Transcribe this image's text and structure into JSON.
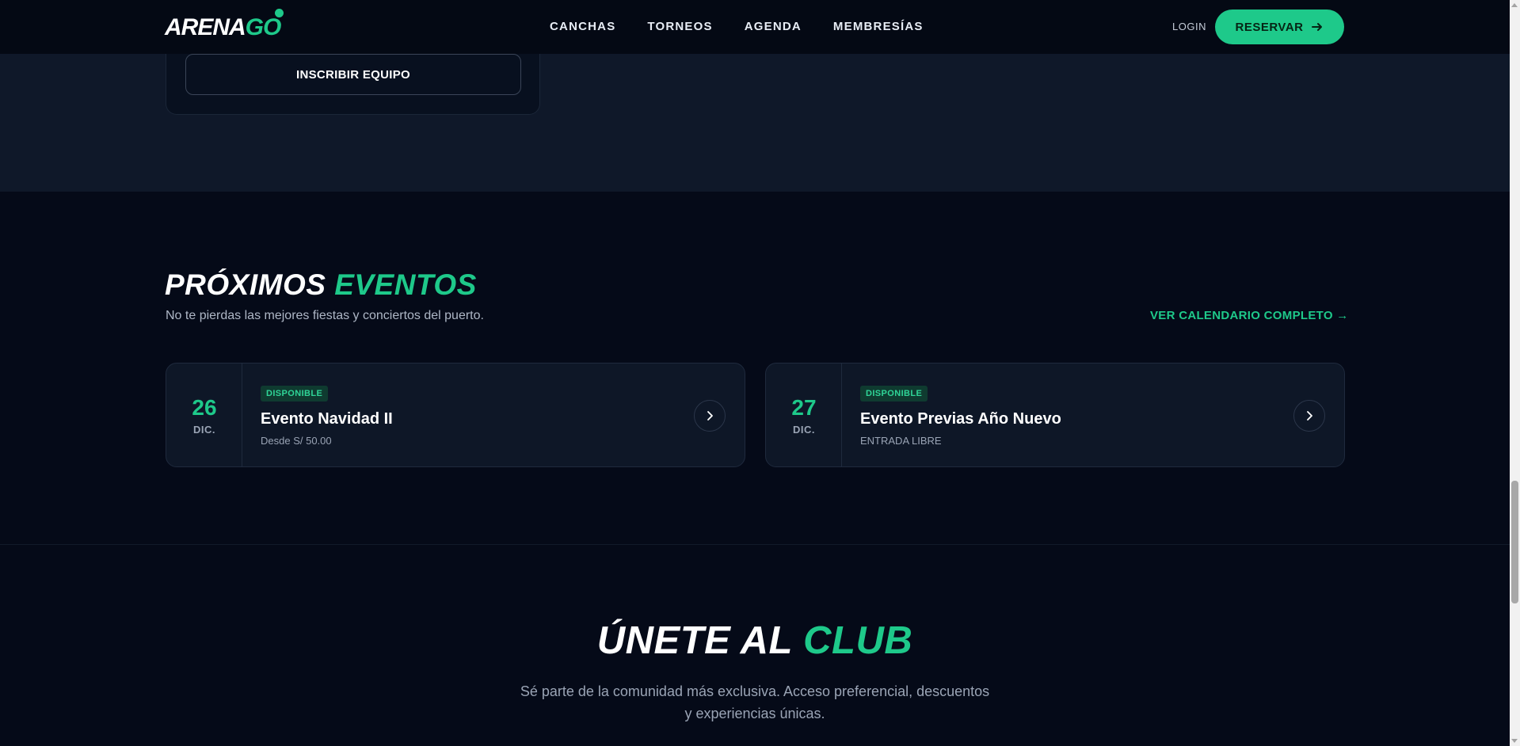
{
  "brand": {
    "logo_main": "ARENA",
    "logo_accent": "GO"
  },
  "nav": {
    "items": [
      "CANCHAS",
      "TORNEOS",
      "AGENDA",
      "MEMBRESÍAS"
    ]
  },
  "header": {
    "login_label": "LOGIN",
    "reserve_label": "RESERVAR"
  },
  "tournament": {
    "register_label": "INSCRIBIR EQUIPO"
  },
  "events": {
    "title_main": "PRÓXIMOS",
    "title_accent": "EVENTOS",
    "subtitle": "No te pierdas las mejores fiestas y conciertos del puerto.",
    "calendar_link": "VER CALENDARIO COMPLETO →",
    "items": [
      {
        "day": "26",
        "month": "DIC.",
        "badge": "DISPONIBLE",
        "name": "Evento Navidad II",
        "price": "Desde S/ 50.00"
      },
      {
        "day": "27",
        "month": "DIC.",
        "badge": "DISPONIBLE",
        "name": "Evento Previas Año Nuevo",
        "price": "ENTRADA LIBRE"
      }
    ]
  },
  "club": {
    "title_main": "ÚNETE AL",
    "title_accent": "CLUB",
    "subtitle": "Sé parte de la comunidad más exclusiva. Acceso preferencial, descuentos y experiencias únicas."
  },
  "colors": {
    "accent": "#1ec98a",
    "background": "#050a18",
    "surface": "#0e1727"
  }
}
